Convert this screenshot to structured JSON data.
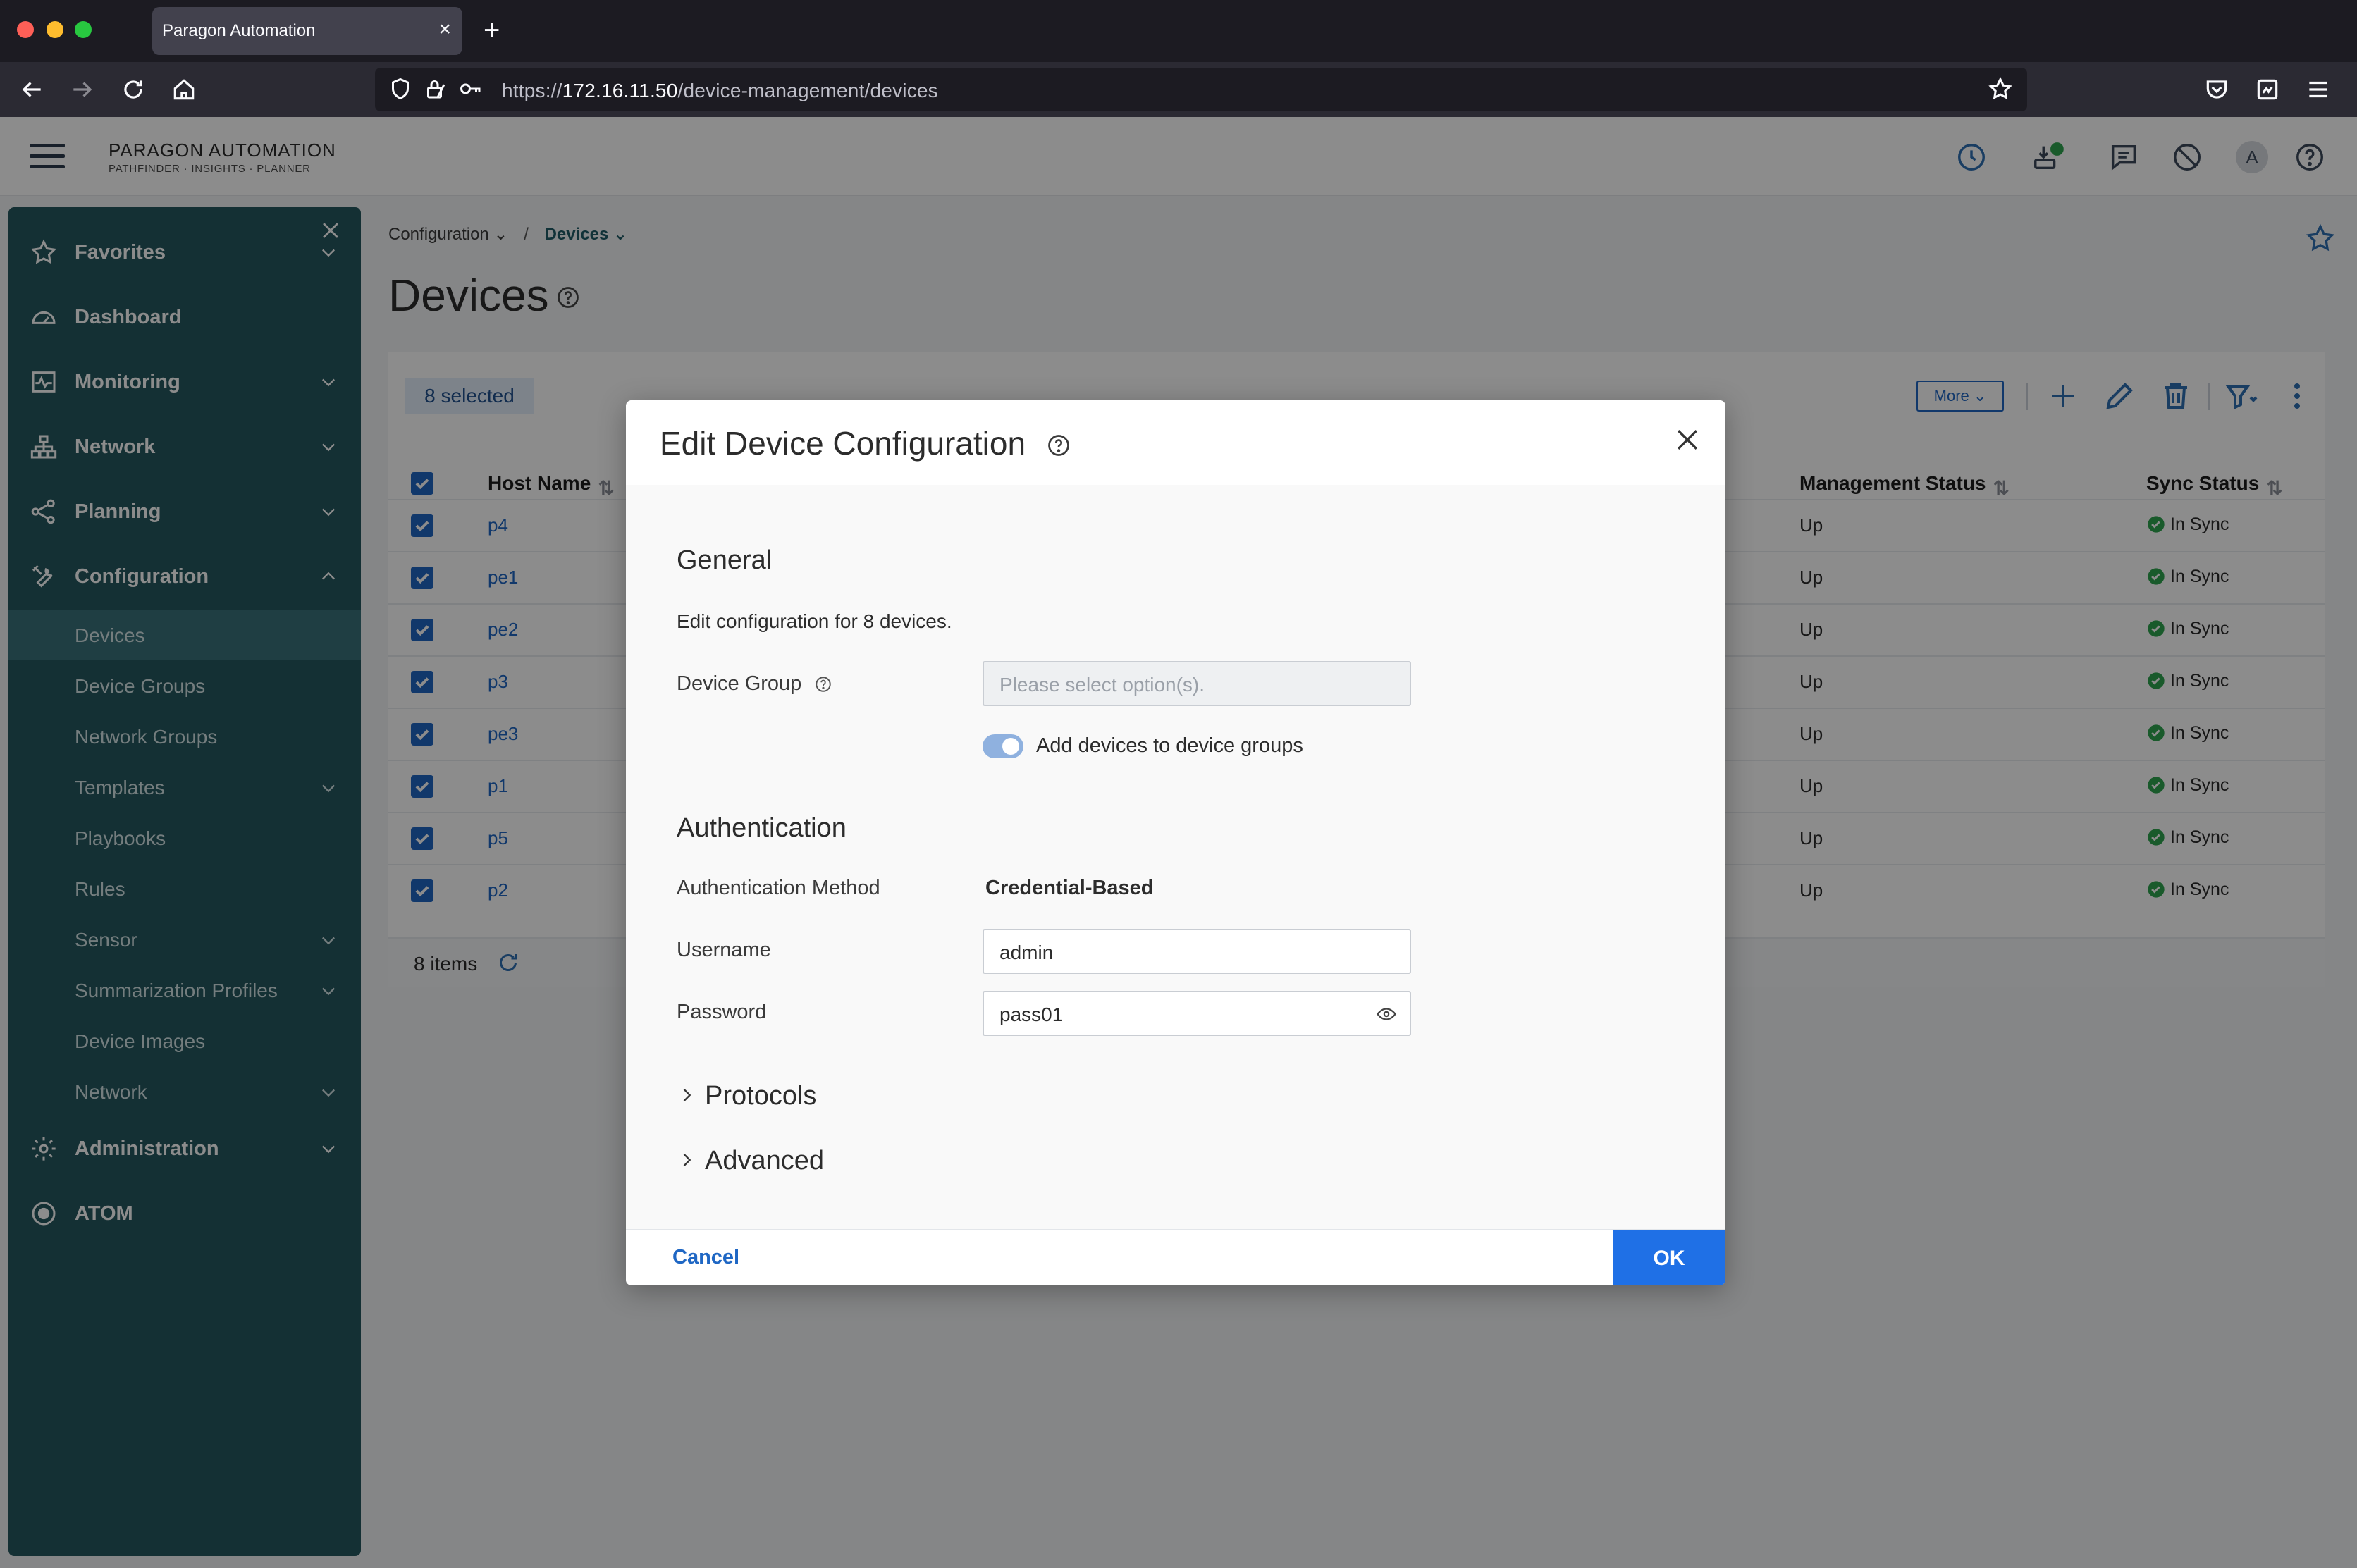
{
  "browser": {
    "tab_title": "Paragon Automation",
    "url_prefix": "https://",
    "url_host": "172.16.11.50",
    "url_path": "/device-management/devices"
  },
  "header": {
    "brand_main": "PARAGON AUTOMATION",
    "brand_sub": "PATHFINDER · INSIGHTS · PLANNER",
    "avatar_initial": "A"
  },
  "sidebar": {
    "items": [
      {
        "label": "Favorites",
        "icon": "star-icon",
        "expandable": true
      },
      {
        "label": "Dashboard",
        "icon": "dashboard-icon",
        "expandable": false
      },
      {
        "label": "Monitoring",
        "icon": "monitoring-icon",
        "expandable": true
      },
      {
        "label": "Network",
        "icon": "network-icon",
        "expandable": true
      },
      {
        "label": "Planning",
        "icon": "planning-icon",
        "expandable": true
      },
      {
        "label": "Configuration",
        "icon": "configuration-icon",
        "expanded": true
      },
      {
        "label": "Administration",
        "icon": "gear-icon",
        "expandable": true
      },
      {
        "label": "ATOM",
        "icon": "atom-icon",
        "expandable": false
      }
    ],
    "config_children": [
      {
        "label": "Devices",
        "active": true
      },
      {
        "label": "Device Groups"
      },
      {
        "label": "Network Groups"
      },
      {
        "label": "Templates",
        "expandable": true
      },
      {
        "label": "Playbooks"
      },
      {
        "label": "Rules"
      },
      {
        "label": "Sensor",
        "expandable": true
      },
      {
        "label": "Summarization Profiles",
        "expandable": true
      },
      {
        "label": "Device Images"
      },
      {
        "label": "Network",
        "expandable": true
      }
    ]
  },
  "breadcrumb": {
    "parent": "Configuration",
    "separator": "/",
    "current": "Devices"
  },
  "page": {
    "title": "Devices"
  },
  "table": {
    "selected_label": "8 selected",
    "more_label": "More",
    "columns": {
      "host": "Host Name",
      "mgmt": "Management Status",
      "sync": "Sync Status"
    },
    "rows": [
      {
        "host": "p4",
        "mgmt": "Up",
        "sync": "In Sync"
      },
      {
        "host": "pe1",
        "mgmt": "Up",
        "sync": "In Sync"
      },
      {
        "host": "pe2",
        "mgmt": "Up",
        "sync": "In Sync"
      },
      {
        "host": "p3",
        "mgmt": "Up",
        "sync": "In Sync"
      },
      {
        "host": "pe3",
        "mgmt": "Up",
        "sync": "In Sync"
      },
      {
        "host": "p1",
        "mgmt": "Up",
        "sync": "In Sync"
      },
      {
        "host": "p5",
        "mgmt": "Up",
        "sync": "In Sync"
      },
      {
        "host": "p2",
        "mgmt": "Up",
        "sync": "In Sync"
      }
    ],
    "footer_count": "8 items"
  },
  "modal": {
    "title": "Edit Device Configuration",
    "general_heading": "General",
    "general_desc": "Edit configuration for 8 devices.",
    "device_group_label": "Device Group",
    "device_group_placeholder": "Please select option(s).",
    "toggle_label": "Add devices to device groups",
    "toggle_on": true,
    "auth_heading": "Authentication",
    "auth_method_label": "Authentication Method",
    "auth_method_value": "Credential-Based",
    "username_label": "Username",
    "username_value": "admin",
    "password_label": "Password",
    "password_value": "pass01",
    "protocols_label": "Protocols",
    "advanced_label": "Advanced",
    "cancel_label": "Cancel",
    "ok_label": "OK"
  },
  "colors": {
    "sidebar_bg": "#25585f",
    "sidebar_active": "#3a727a",
    "primary": "#1f67c4",
    "ok_button": "#1f70e6",
    "sync_ok": "#2ea44f"
  }
}
